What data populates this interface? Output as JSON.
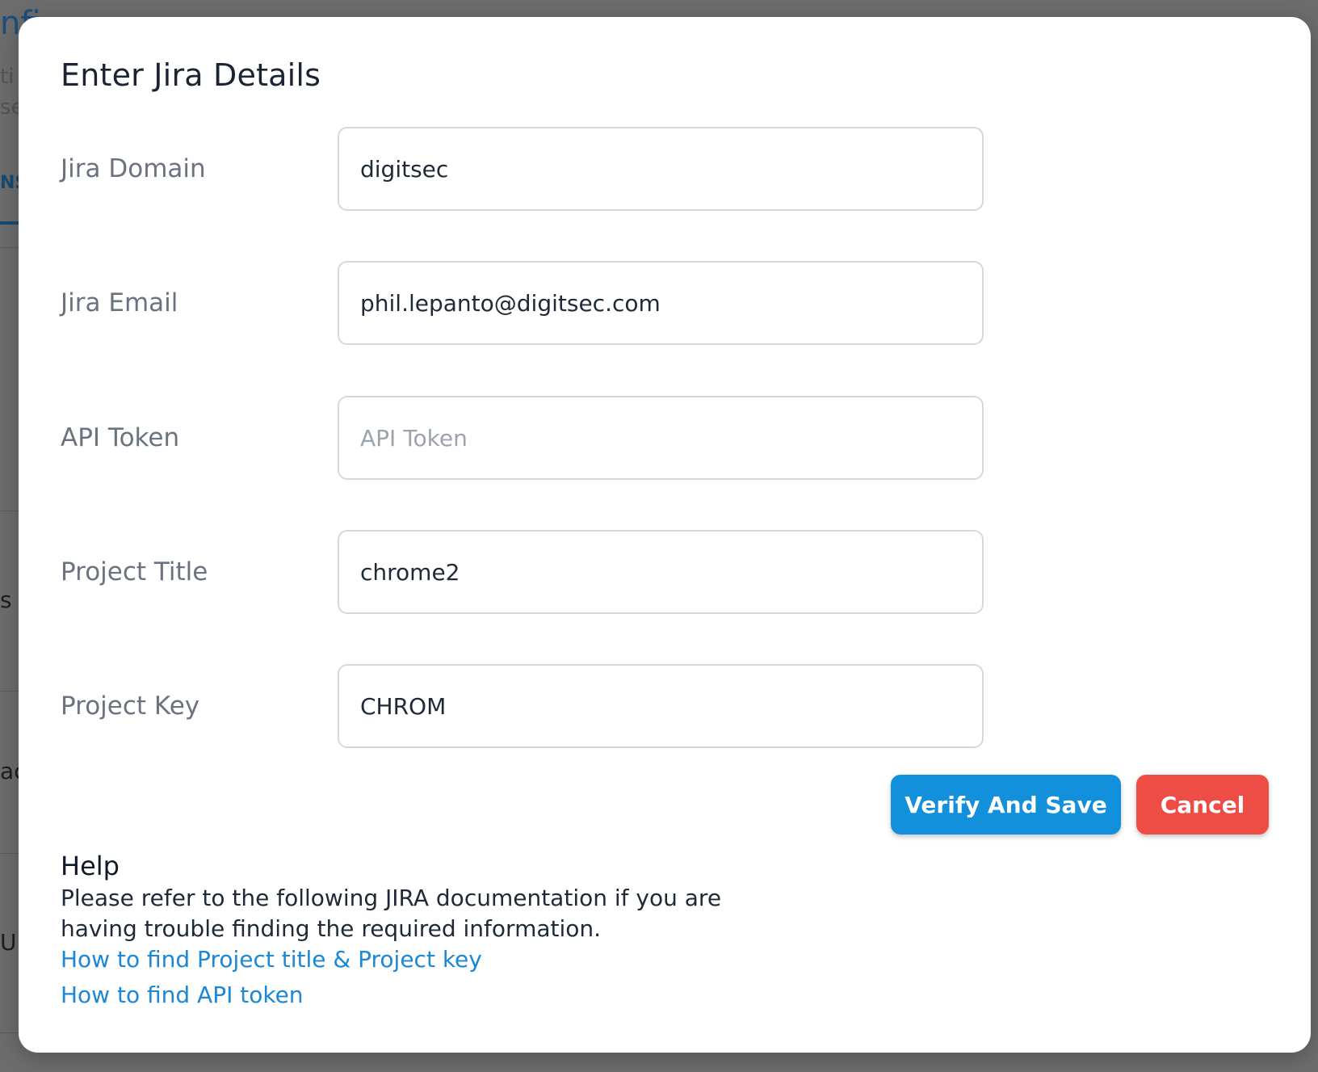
{
  "background": {
    "heading_fragment": "nfi",
    "line1_fragment": "ti",
    "line2_fragment": "se",
    "tab_fragment": "NS",
    "item1_fragment": "s",
    "item2_fragment": "ac",
    "item3_fragment": "U"
  },
  "modal": {
    "title": "Enter Jira Details",
    "fields": [
      {
        "label": "Jira Domain",
        "value": "digitsec",
        "placeholder": ""
      },
      {
        "label": "Jira Email",
        "value": "phil.lepanto@digitsec.com",
        "placeholder": ""
      },
      {
        "label": "API Token",
        "value": "",
        "placeholder": "API Token"
      },
      {
        "label": "Project Title",
        "value": "chrome2",
        "placeholder": ""
      },
      {
        "label": "Project Key",
        "value": "CHROM",
        "placeholder": ""
      }
    ],
    "buttons": {
      "verify_label": "Verify And Save",
      "cancel_label": "Cancel"
    },
    "help": {
      "title": "Help",
      "text": "Please refer to the following JIRA documentation if you are having trouble finding the required information.",
      "link_project": "How to find Project title & Project key",
      "link_api": "How to find API token"
    }
  },
  "colors": {
    "primary": "#1290dc",
    "danger": "#ee4d46",
    "link": "#1b87d6",
    "overlay": "#6d6d6d"
  }
}
